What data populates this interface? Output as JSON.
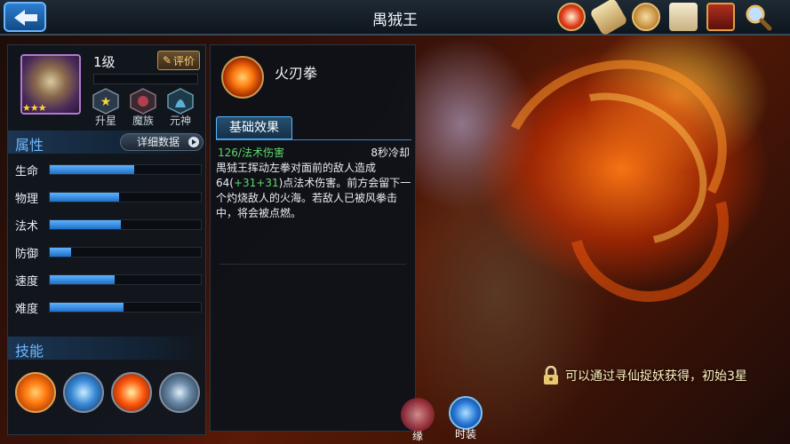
{
  "header": {
    "title": "禺狨王",
    "icons": [
      "battle-icon",
      "scroll-icon",
      "coin-icon",
      "notice-icon",
      "book-icon",
      "search-icon"
    ]
  },
  "hero": {
    "level": "1级",
    "stars": 3,
    "rate_label": "评价",
    "badges": [
      {
        "label": "升星",
        "icon": "star-badge-icon"
      },
      {
        "label": "魔族",
        "icon": "demon-badge-icon"
      },
      {
        "label": "元神",
        "icon": "spirit-badge-icon"
      }
    ]
  },
  "attributes": {
    "title": "属性",
    "detail_label": "详细数据",
    "rows": [
      {
        "name": "生命",
        "level": 0.56
      },
      {
        "name": "物理",
        "level": 0.46
      },
      {
        "name": "法术",
        "level": 0.47
      },
      {
        "name": "防御",
        "level": 0.14
      },
      {
        "name": "速度",
        "level": 0.43
      },
      {
        "name": "难度",
        "level": 0.49
      }
    ]
  },
  "skills": {
    "title": "技能",
    "items": [
      "skill-fire-fist-icon",
      "skill-lightning-fist-icon",
      "skill-blast-icon",
      "skill-whirlwind-icon"
    ]
  },
  "skill_detail": {
    "name": "火刃拳",
    "tab_label": "基础效果",
    "damage_type": "126/法术伤害",
    "cooldown": "8秒冷却",
    "desc_part1": "禺狨王挥动左拳对面前的敌人造成64(",
    "desc_bonus": "+31+31",
    "desc_part2": ")点法术伤害。前方会留下一个灼烧敌人的火海。若敌人已被风拳击中，将会被点燃。"
  },
  "bottom_tabs": [
    {
      "label": "缘",
      "icon": "fate-icon"
    },
    {
      "label": "时装",
      "icon": "costume-icon"
    }
  ],
  "unlock_note": "可以通过寻仙捉妖获得，初始3星"
}
